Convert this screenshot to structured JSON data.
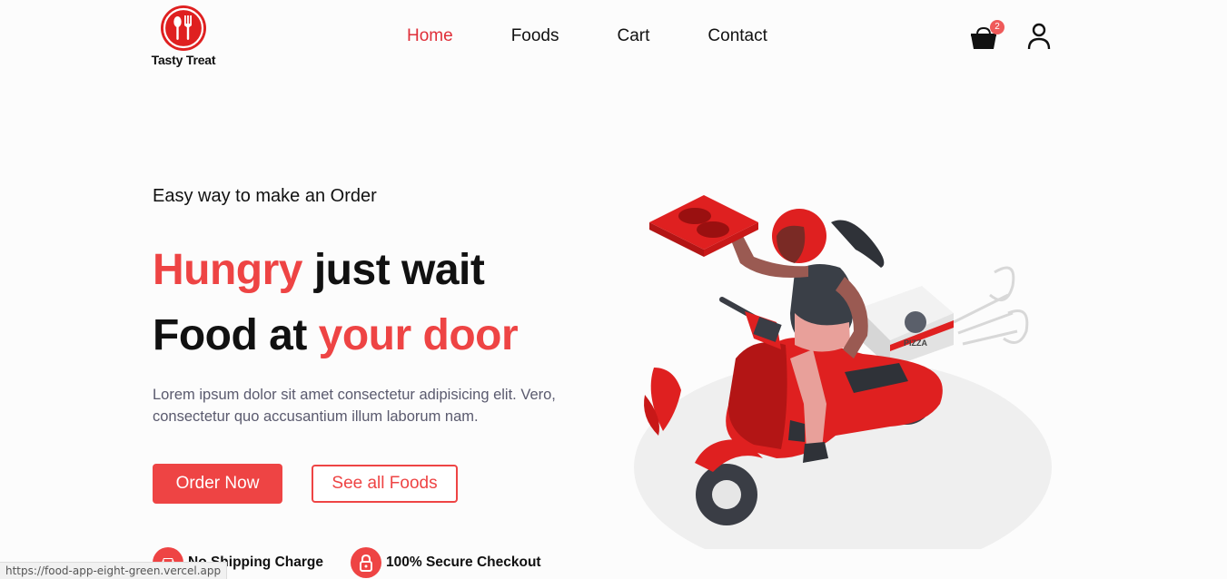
{
  "header": {
    "brand": "Tasty Treat",
    "nav": [
      "Home",
      "Foods",
      "Cart",
      "Contact"
    ],
    "active_nav": "Home",
    "cart_count": "2"
  },
  "hero": {
    "tagline": "Easy way to make an Order",
    "headline_line1_red": "Hungry",
    "headline_line1_rest": " just wait",
    "headline_line2_start": "Food at ",
    "headline_line2_red": "your door",
    "description": "Lorem ipsum dolor sit amet consectetur adipisicing elit. Vero, consectetur quo accusantium illum laborum nam.",
    "primary_button": "Order Now",
    "secondary_button": "See all Foods",
    "features": [
      {
        "icon": "car-icon",
        "label": "No Shipping Charge"
      },
      {
        "icon": "lock-icon",
        "label": "100% Secure Checkout"
      }
    ],
    "illustration_text": "PIZZA"
  },
  "status_bar": {
    "url": "https://food-app-eight-green.vercel.app"
  },
  "colors": {
    "accent": "#ee4444",
    "logo_red": "#df2020",
    "text": "#111111",
    "muted": "#5a5a6e"
  }
}
